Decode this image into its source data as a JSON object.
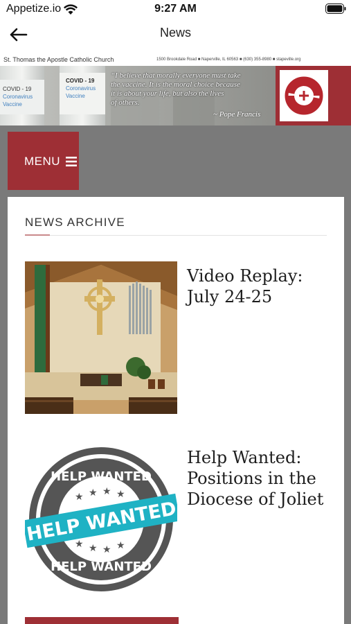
{
  "status_bar": {
    "carrier": "Appetize.io",
    "time": "9:27 AM"
  },
  "nav": {
    "title": "News"
  },
  "banner": {
    "church_name": "St. Thomas the Apostle Catholic Church",
    "address": "1500 Brookdale Road  ■  Naperville, IL  60563  ■  (630) 355-8980  ■  stapeville.org",
    "quote_lines": [
      "“I believe that morally everyone must take",
      "the vaccine. It is the moral choice because",
      "it is about your life, but also the lives",
      "of others."
    ],
    "attribution": "~ Pope Francis",
    "vial_1_labels": [
      "COVID - 19",
      "Coronavirus",
      "Vaccine"
    ],
    "vial_2_labels": [
      "COVID - 19",
      "Coronavirus",
      "Vaccine"
    ]
  },
  "menu": {
    "label": "MENU"
  },
  "section": {
    "title": "NEWS ARCHIVE"
  },
  "articles": [
    {
      "title": "Video Replay: July 24-25",
      "thumbnail": "church-interior-image"
    },
    {
      "title": "Help Wanted: Positions in the Diocese of Joliet",
      "thumbnail": "help-wanted-stamp-image"
    }
  ],
  "help_wanted_stamp": {
    "main": "HELP WANTED",
    "ring": "HELP WANTED"
  },
  "colors": {
    "brand_red": "#9e2f35",
    "gray_background": "#7a7a7a",
    "stamp_teal": "#1fb2c4"
  }
}
